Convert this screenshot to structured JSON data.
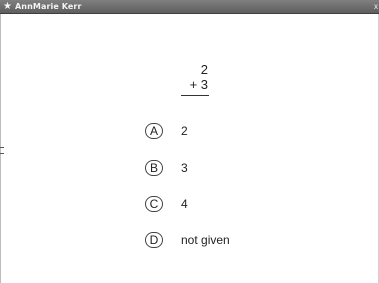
{
  "window": {
    "title": "AnnMarie Kerr",
    "icon": "star-icon",
    "close_glyph": "x"
  },
  "problem": {
    "top_number": "2",
    "operator_line": "+ 3"
  },
  "options": [
    {
      "letter": "A",
      "text": "2"
    },
    {
      "letter": "B",
      "text": "3"
    },
    {
      "letter": "C",
      "text": "4"
    },
    {
      "letter": "D",
      "text": "not given"
    }
  ]
}
